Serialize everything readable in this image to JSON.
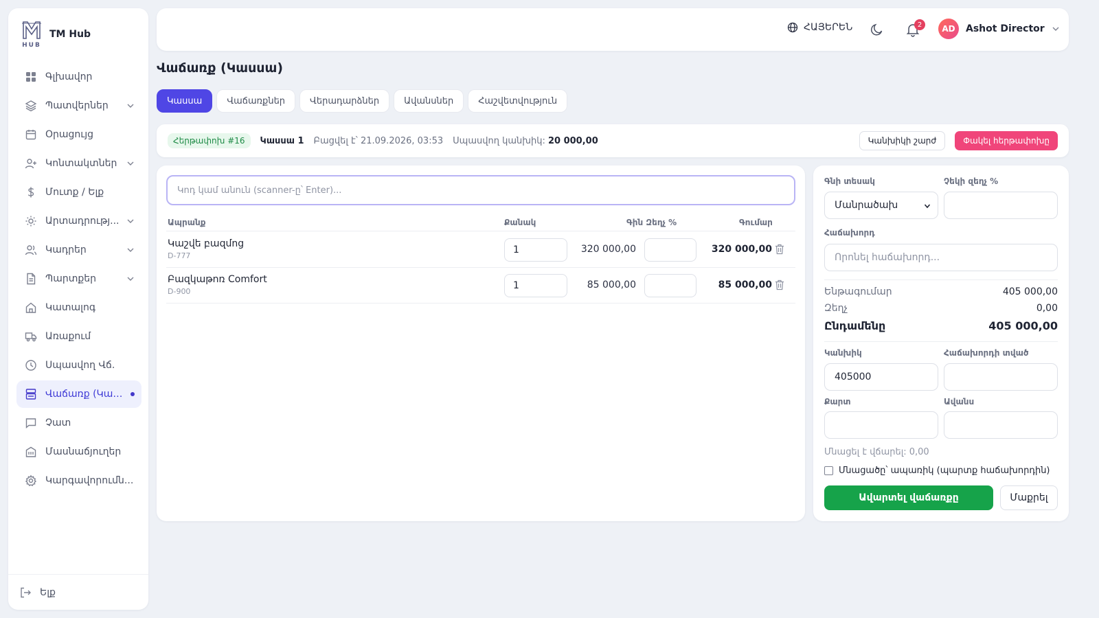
{
  "brand": {
    "name": "TM Hub",
    "logo_text": "HUB"
  },
  "sidebar": {
    "items": [
      {
        "label": "Գլխավոր",
        "icon": "dashboard-icon",
        "chevron": false
      },
      {
        "label": "Պատվերներ",
        "icon": "layers-icon",
        "chevron": true
      },
      {
        "label": "Օրացույց",
        "icon": "calendar-icon",
        "chevron": false
      },
      {
        "label": "Կոնտակտներ",
        "icon": "user-plus-icon",
        "chevron": true
      },
      {
        "label": "Մուտք / Ելք",
        "icon": "dollar-icon",
        "chevron": false
      },
      {
        "label": "Արտադրությ...",
        "icon": "sun-icon",
        "chevron": true
      },
      {
        "label": "Կադրեր",
        "icon": "users-icon",
        "chevron": true
      },
      {
        "label": "Պարտքեր",
        "icon": "document-icon",
        "chevron": true
      },
      {
        "label": "Կատալոգ",
        "icon": "home-icon",
        "chevron": false
      },
      {
        "label": "Առաքում",
        "icon": "truck-icon",
        "chevron": false
      },
      {
        "label": "Սպասվող Վճ.",
        "icon": "clock-icon",
        "chevron": false
      },
      {
        "label": "Վաճառք (Կաս...",
        "icon": "register-icon",
        "chevron": false,
        "active": true
      },
      {
        "label": "Չատ",
        "icon": "chat-icon",
        "chevron": false
      },
      {
        "label": "Մասնաճյուղեր",
        "icon": "building-icon",
        "chevron": false
      },
      {
        "label": "Կարգավորումն...",
        "icon": "gear-icon",
        "chevron": false
      }
    ],
    "logout_label": "Ելք"
  },
  "header": {
    "language": "ՀԱՅԵՐԵՆ",
    "notification_count": "2",
    "user_initials": "AD",
    "user_name": "Ashot Director"
  },
  "page": {
    "title": "Վաճառք (Կասսա)",
    "tabs": [
      {
        "label": "Կասսա",
        "active": true
      },
      {
        "label": "Վաճառքներ"
      },
      {
        "label": "Վերադարձներ"
      },
      {
        "label": "Ավանսներ"
      },
      {
        "label": "Հաշվետվություն"
      }
    ]
  },
  "shift": {
    "badge": "Հերթափոխ #16",
    "register": "Կասսա 1",
    "opened": "Բացվել է՝ 21.09.2026, 03:53",
    "expected_label": "Սպասվող կանխիկ:",
    "expected_value": "20 000,00",
    "cash_move_label": "Կանխիկի շարժ",
    "close_label": "Փակել հերթափոխը"
  },
  "cart": {
    "scan_placeholder": "Կոդ կամ անուն (scanner-ը՝ Enter)...",
    "columns": {
      "product": "Ապրանք",
      "qty": "Քանակ",
      "price_disc": "Գին Զեղչ %",
      "sum": "Գումար"
    },
    "rows": [
      {
        "name": "Կաշվե բազմոց",
        "sku": "D-777",
        "qty": "1",
        "price": "320 000,00",
        "disc": "",
        "sum": "320 000,00"
      },
      {
        "name": "Բազկաթոռ Comfort",
        "sku": "D-900",
        "qty": "1",
        "price": "85 000,00",
        "disc": "",
        "sum": "85 000,00"
      }
    ]
  },
  "payment": {
    "price_type_label": "Գնի տեսակ",
    "price_type_value": "Մանրածախ",
    "check_disc_label": "Չեկի զեղչ %",
    "customer_label": "Հաճախորդ",
    "customer_placeholder": "Որոնել հաճախորդ...",
    "subtotal_label": "Ենթագումար",
    "subtotal_value": "405 000,00",
    "discount_label": "Զեղչ",
    "discount_value": "0,00",
    "total_label": "Ընդամենը",
    "total_value": "405 000,00",
    "cash_label": "Կանխիկ",
    "cash_value": "405000",
    "customer_given_label": "Հաճախորդի տված",
    "card_label": "Քարտ",
    "advance_label": "Ավանս",
    "remaining": "Մնացել է վճարել: 0,00",
    "remainder_checkbox": "Մնացածը՝ ապառիկ (պարտք հաճախորդին)",
    "finish_label": "Ավարտել վաճառքը",
    "clear_label": "Մաքրել"
  },
  "colors": {
    "accent": "#4f46e5",
    "success": "#16a34a",
    "danger": "#f0457a"
  }
}
